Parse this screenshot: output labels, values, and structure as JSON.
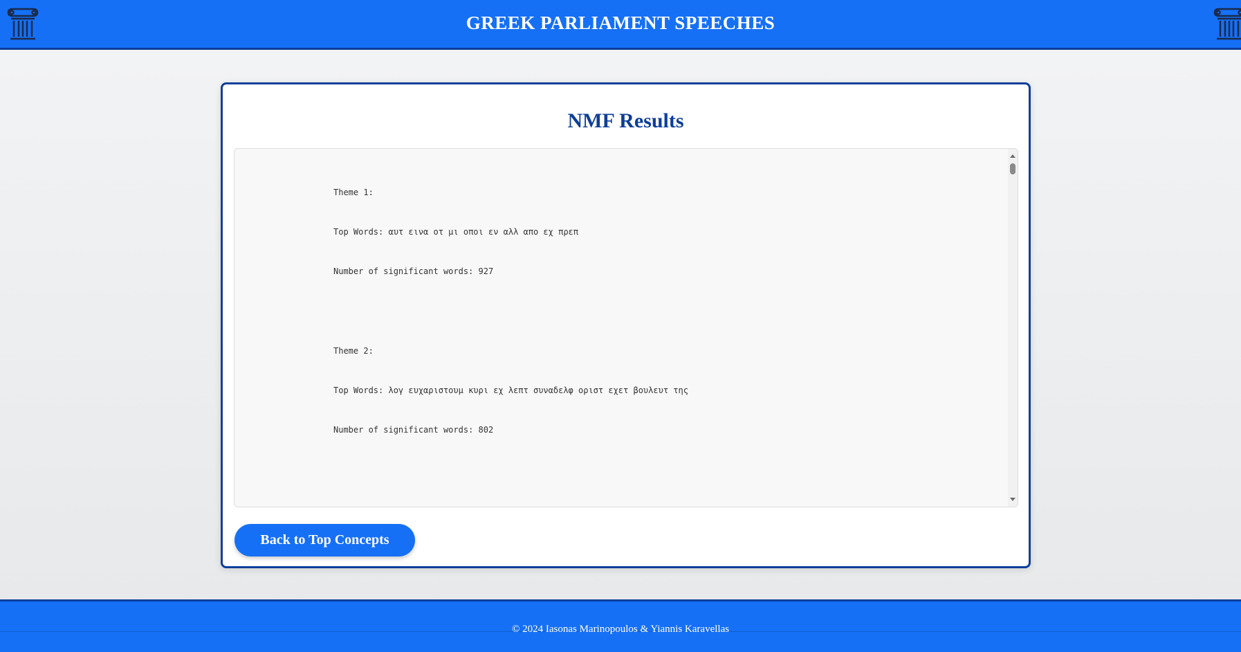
{
  "header": {
    "title": "GREEK PARLIAMENT SPEECHES",
    "left_icon": "greek-pillar-icon",
    "right_icon": "greek-pillar-icon"
  },
  "card": {
    "title": "NMF Results"
  },
  "results": {
    "themes": [
      {
        "heading": "Theme 1:",
        "top_words": "Top Words: αυτ εινα οτ μι οποι εν αλλ απο εχ πρεπ",
        "significant": "Number of significant words: 927"
      },
      {
        "heading": "Theme 2:",
        "top_words": "Top Words: λογ ευχαριστουμ κυρι εχ λεπτ συναδελφ οριστ εχετ βουλευτ της",
        "significant": "Number of significant words: 802"
      }
    ]
  },
  "actions": {
    "back_label": "Back to Top Concepts"
  },
  "footer": {
    "text": "© 2024 Iasonas Marinopoulos & Yiannis Karavellas"
  },
  "colors": {
    "primary": "#1570f5",
    "dark_blue": "#0d3f9a"
  }
}
